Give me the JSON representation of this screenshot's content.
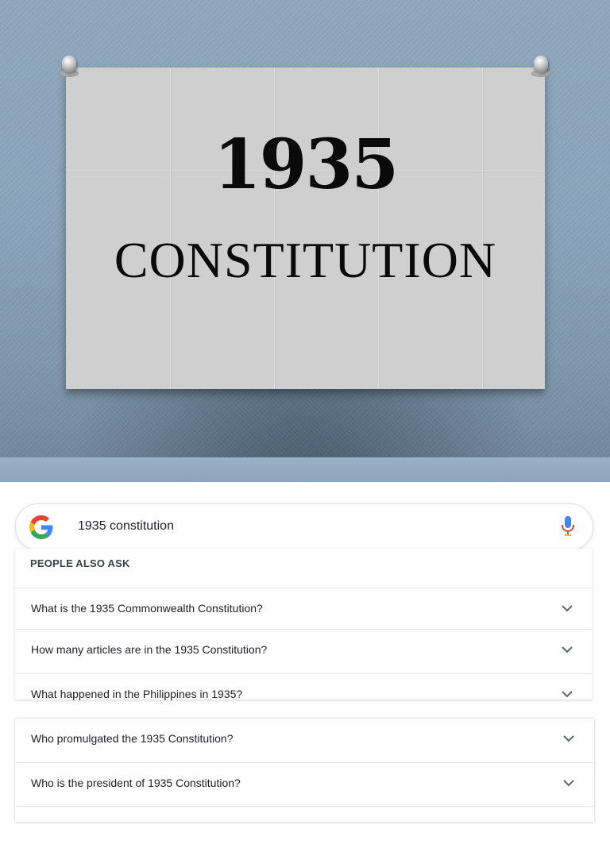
{
  "slide": {
    "year": "1935",
    "word": "CONSTITUTION"
  },
  "search": {
    "query": "1935 constitution",
    "logo_icon": "google-g-icon",
    "mic_icon": "microphone-icon",
    "colors": {
      "blue": "#4285F4",
      "red": "#EA4335",
      "yellow": "#FBBC05",
      "green": "#34A853"
    }
  },
  "people_also_ask": {
    "heading": "PEOPLE ALSO ASK",
    "questions": [
      "What is the 1935 Commonwealth Constitution?",
      "How many articles are in the 1935 Constitution?",
      "What happened in the Philippines in 1935?",
      "Who promulgated the 1935 Constitution?",
      "Who is the president of 1935 Constitution?"
    ],
    "expand_icon": "chevron-down-icon"
  }
}
